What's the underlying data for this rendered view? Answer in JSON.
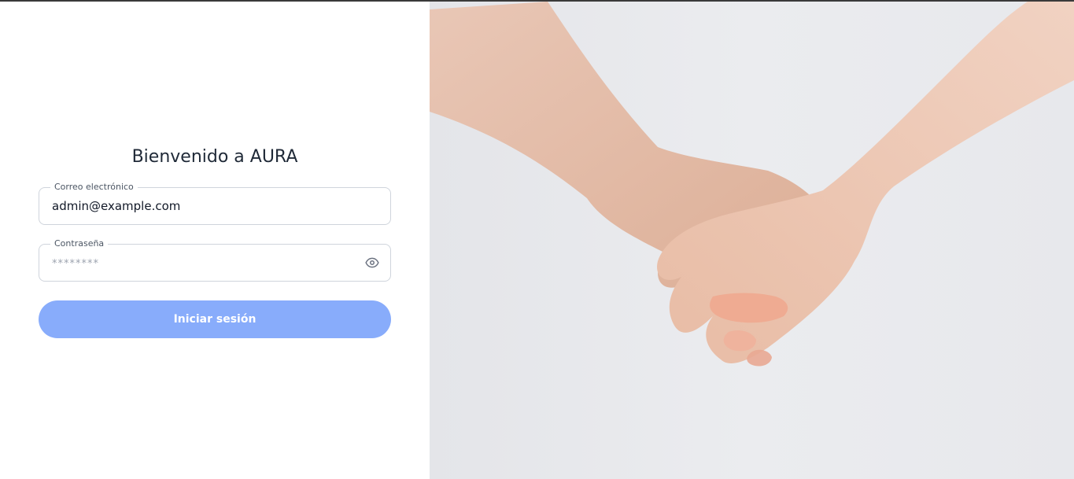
{
  "login": {
    "title": "Bienvenido a AURA",
    "email_label": "Correo electrónico",
    "email_value": "admin@example.com",
    "password_label": "Contraseña",
    "password_placeholder": "********",
    "submit_label": "Iniciar sesión",
    "password_toggle_icon": "eye-icon"
  },
  "colors": {
    "primary_button": "#88acfb",
    "title_text": "#1f2937",
    "field_border": "#cfd4dc",
    "hero_background": "#e8e9ec"
  },
  "hero_image": {
    "subject": "holding-hands"
  }
}
